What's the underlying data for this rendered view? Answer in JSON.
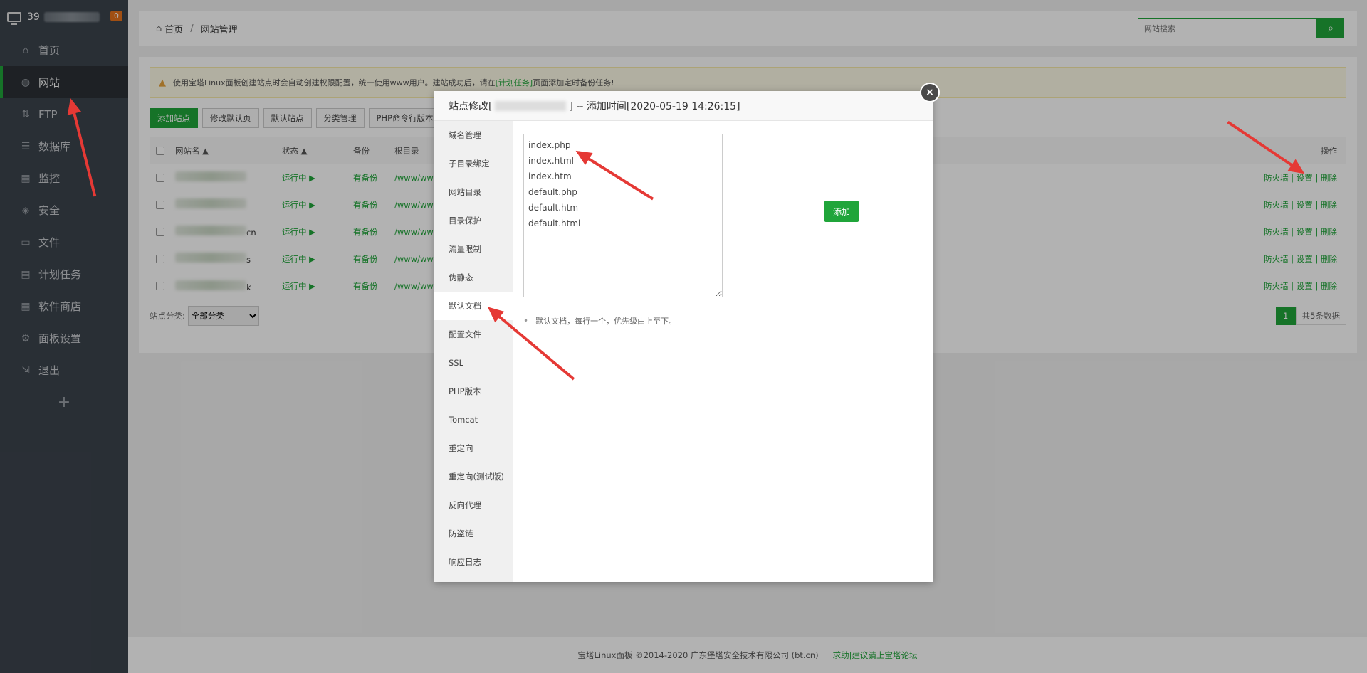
{
  "sidebar": {
    "server_prefix": "39",
    "badge": "0",
    "items": [
      {
        "label": "首页",
        "icon": "home-icon",
        "active": false
      },
      {
        "label": "网站",
        "icon": "globe-icon",
        "active": true
      },
      {
        "label": "FTP",
        "icon": "ftp-icon",
        "active": false
      },
      {
        "label": "数据库",
        "icon": "database-icon",
        "active": false
      },
      {
        "label": "监控",
        "icon": "monitor-icon",
        "active": false
      },
      {
        "label": "安全",
        "icon": "shield-icon",
        "active": false
      },
      {
        "label": "文件",
        "icon": "folder-icon",
        "active": false
      },
      {
        "label": "计划任务",
        "icon": "calendar-icon",
        "active": false
      },
      {
        "label": "软件商店",
        "icon": "grid-icon",
        "active": false
      },
      {
        "label": "面板设置",
        "icon": "gear-icon",
        "active": false
      },
      {
        "label": "退出",
        "icon": "logout-icon",
        "active": false
      }
    ],
    "add_label": "+"
  },
  "header": {
    "crumb_home": "首页",
    "crumb_sep": "/",
    "crumb_current": "网站管理",
    "search_placeholder": "网站搜索"
  },
  "notice": {
    "text_before": "使用宝塔Linux面板创建站点时会自动创建权限配置，统一使用www用户。建站成功后，请在",
    "link": "[计划任务]",
    "text_after": "页面添加定时备份任务!"
  },
  "toolbar": {
    "buttons": [
      "添加站点",
      "修改默认页",
      "默认站点",
      "分类管理",
      "PHP命令行版本"
    ]
  },
  "table": {
    "headers": {
      "name": "网站名 ▲",
      "state": "状态 ▲",
      "backup": "备份",
      "root": "根目录",
      "ops": "操作"
    },
    "rows": [
      {
        "state": "运行中 ▶",
        "backup": "有备份",
        "root": "/www/ww",
        "ops": "防火墙 | 设置 | 删除",
        "name_tail": ""
      },
      {
        "state": "运行中 ▶",
        "backup": "有备份",
        "root": "/www/ww",
        "ops": "防火墙 | 设置 | 删除",
        "name_tail": ""
      },
      {
        "state": "运行中 ▶",
        "backup": "有备份",
        "root": "/www/ww",
        "ops": "防火墙 | 设置 | 删除",
        "name_tail": "cn"
      },
      {
        "state": "运行中 ▶",
        "backup": "有备份",
        "root": "/www/ww",
        "ops": "防火墙 | 设置 | 删除",
        "name_tail": "s"
      },
      {
        "state": "运行中 ▶",
        "backup": "有备份",
        "root": "/www/ww",
        "ops": "防火墙 | 设置 | 删除",
        "name_tail": "k"
      }
    ]
  },
  "table_footer": {
    "category_label": "站点分类:",
    "category_value": "全部分类",
    "page": "1",
    "total": "共5条数据"
  },
  "footer": {
    "copyright": "宝塔Linux面板 ©2014-2020 广东堡塔安全技术有限公司 (bt.cn)",
    "link": "求助|建议请上宝塔论坛"
  },
  "modal": {
    "title_prefix": "站点修改[",
    "title_suffix": "] -- 添加时间[2020-05-19 14:26:15]",
    "close": "×",
    "menu": [
      "域名管理",
      "子目录绑定",
      "网站目录",
      "目录保护",
      "流量限制",
      "伪静态",
      "默认文档",
      "配置文件",
      "SSL",
      "PHP版本",
      "Tomcat",
      "重定向",
      "重定向(测试版)",
      "反向代理",
      "防盗链",
      "响应日志"
    ],
    "active_menu": "默认文档",
    "docs": "index.php\nindex.html\nindex.htm\ndefault.php\ndefault.htm\ndefault.html",
    "add_label": "添加",
    "hint": "默认文档，每行一个，优先级由上至下。"
  },
  "colors": {
    "accent": "#20a53a",
    "sidebar": "#3c444d",
    "arrow": "#e53935"
  }
}
